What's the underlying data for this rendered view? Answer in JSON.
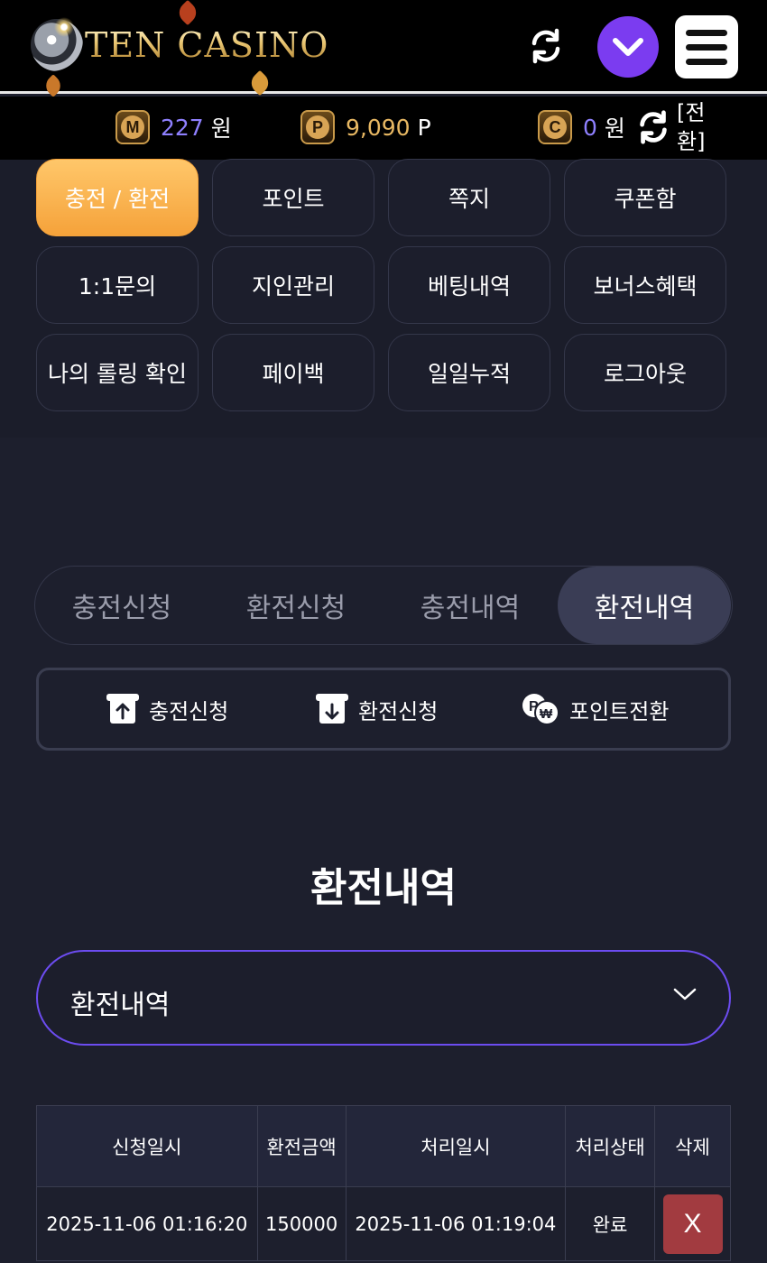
{
  "header": {
    "logo_text": "TEN CASINO",
    "icons": {
      "refresh": "refresh-icon",
      "dropdown": "chevron-down-icon",
      "menu": "hamburger-icon"
    },
    "colors": {
      "dropdown_bg": "#7b3cf0"
    }
  },
  "balance": {
    "money": {
      "badge": "M",
      "value": "227",
      "unit": "원"
    },
    "point": {
      "badge": "P",
      "value": "9,090",
      "unit": "P"
    },
    "casino": {
      "badge": "C",
      "value": "0",
      "unit": "원"
    },
    "convert_label": "[전환]"
  },
  "menu_grid": [
    {
      "label": "충전 / 환전",
      "active": true
    },
    {
      "label": "포인트"
    },
    {
      "label": "쪽지"
    },
    {
      "label": "쿠폰함"
    },
    {
      "label": "1:1문의"
    },
    {
      "label": "지인관리"
    },
    {
      "label": "베팅내역"
    },
    {
      "label": "보너스혜택"
    },
    {
      "label": "나의 롤링 확인"
    },
    {
      "label": "페이백"
    },
    {
      "label": "일일누적"
    },
    {
      "label": "로그아웃"
    }
  ],
  "tabs": [
    {
      "label": "충전신청"
    },
    {
      "label": "환전신청"
    },
    {
      "label": "충전내역"
    },
    {
      "label": "환전내역",
      "active": true
    }
  ],
  "quick_actions": [
    {
      "label": "충전신청",
      "icon": "deposit-icon"
    },
    {
      "label": "환전신청",
      "icon": "withdraw-icon"
    },
    {
      "label": "포인트전환",
      "icon": "point-convert-icon"
    }
  ],
  "section_title": "환전내역",
  "filter_select": {
    "value": "환전내역"
  },
  "table": {
    "headers": [
      "신청일시",
      "환전금액",
      "처리일시",
      "처리상태",
      "삭제"
    ],
    "rows": [
      {
        "requested": "2025-11-06 01:16:20",
        "amount": "150000",
        "processed": "2025-11-06 01:19:04",
        "status": "완료",
        "delete": "X"
      }
    ]
  }
}
